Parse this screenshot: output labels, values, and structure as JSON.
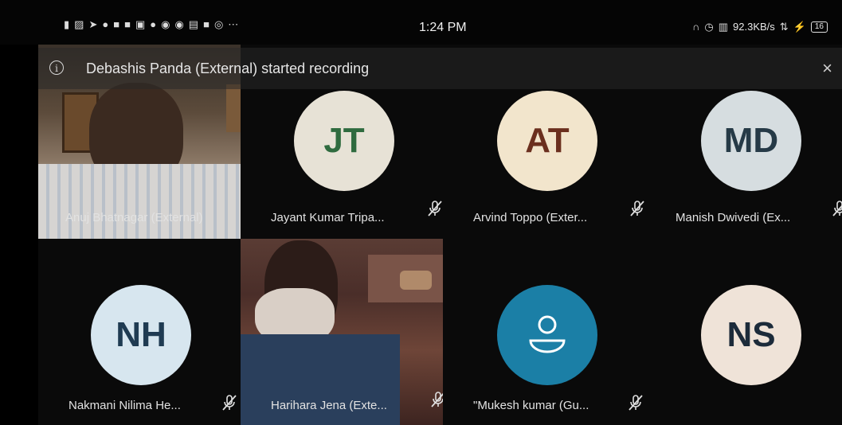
{
  "status_bar": {
    "time": "1:24 PM",
    "network_speed": "92.3KB/s",
    "battery": "16"
  },
  "banner": {
    "text": "Debashis Panda (External) started recording",
    "close_label": "×"
  },
  "participants": [
    {
      "name": "Anuj Bhatnagar (External)",
      "initials": "",
      "video": true
    },
    {
      "name": "Jayant Kumar Tripa...",
      "initials": "JT",
      "video": false,
      "avatar_bg": "#e7e2d6",
      "avatar_fg": "#2f6b3f"
    },
    {
      "name": "Arvind Toppo (Exter...",
      "initials": "AT",
      "video": false,
      "avatar_bg": "#f2e5cc",
      "avatar_fg": "#6b2f1e"
    },
    {
      "name": "Manish Dwivedi (Ex...",
      "initials": "MD",
      "video": false,
      "avatar_bg": "#d6dde0",
      "avatar_fg": "#263a47"
    },
    {
      "name": "Nakmani Nilima He...",
      "initials": "NH",
      "video": false,
      "avatar_bg": "#d7e6ef",
      "avatar_fg": "#1f3b52"
    },
    {
      "name": "Harihara Jena (Exte...",
      "initials": "",
      "video": true
    },
    {
      "name": "\"Mukesh kumar (Gu...",
      "initials": "",
      "video": false,
      "avatar_bg": "#1b7fa6",
      "avatar_fg": "#ffffff"
    },
    {
      "name": "",
      "initials": "NS",
      "video": false,
      "avatar_bg": "#efe3d8",
      "avatar_fg": "#1c2b3a"
    }
  ]
}
